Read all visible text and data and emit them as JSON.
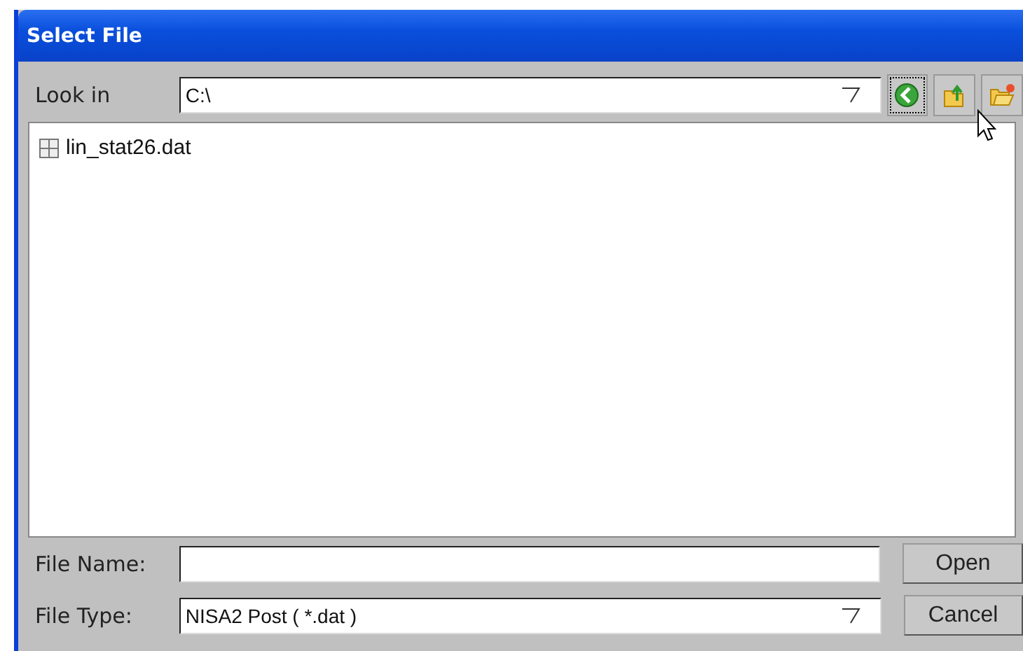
{
  "window": {
    "title": "Select File"
  },
  "look_in": {
    "label": "Look in",
    "value": "C:\\"
  },
  "files": [
    {
      "name": "lin_stat26.dat",
      "selected": false
    }
  ],
  "file_name": {
    "label": "File Name:"
  },
  "file_type": {
    "label": "File Type:",
    "value": "NISA2 Post ( *.dat )"
  },
  "buttons": [
    "Open",
    "Cancel"
  ]
}
